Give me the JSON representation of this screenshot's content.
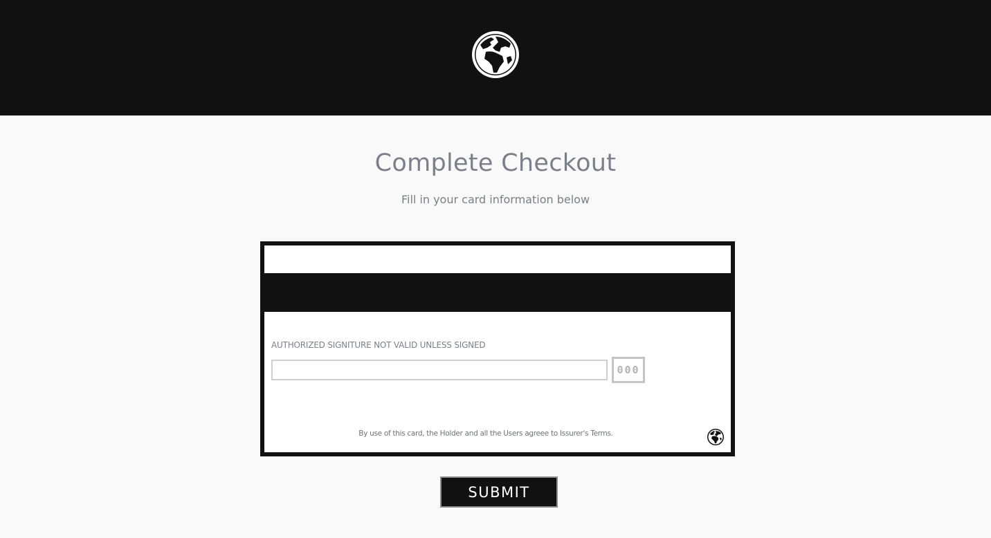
{
  "header": {
    "logo_icon": "globe-icon",
    "background": "#121112"
  },
  "checkout": {
    "title": "Complete Checkout",
    "subtitle": "Fill in your card information below"
  },
  "card": {
    "signature_label": "AUTHORIZED SIGNITURE NOT VALID UNLESS SIGNED",
    "signature_value": "",
    "cvv_placeholder": "000",
    "terms": "By use of this card, the Holder and all the Users agreee to Issurer's Terms.",
    "badge_icon": "globe-icon"
  },
  "submit": {
    "label": "SUBMIT"
  },
  "colors": {
    "dark": "#121112",
    "page_bg": "#f9f9f9",
    "muted_text": "#7b7f87"
  }
}
